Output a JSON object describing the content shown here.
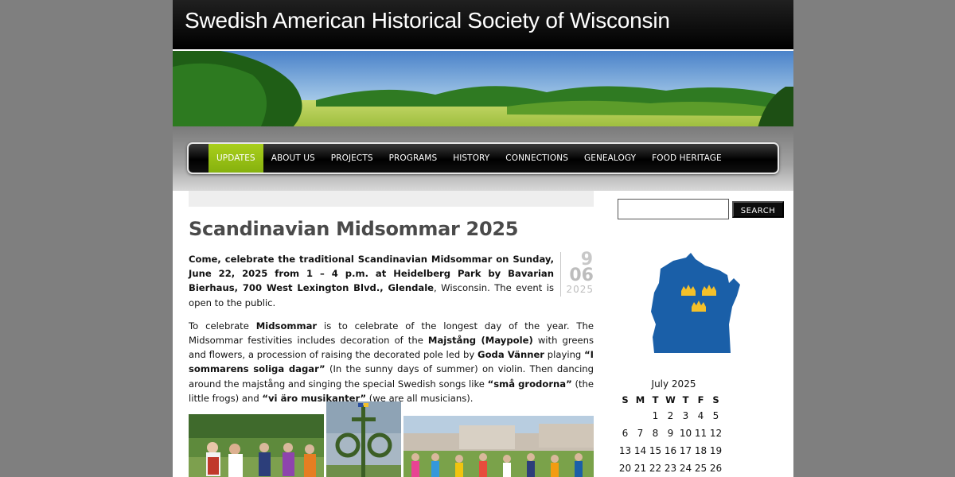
{
  "site": {
    "title": "Swedish American Historical Society of Wisconsin"
  },
  "nav": {
    "items": [
      "UPDATES",
      "ABOUT US",
      "PROJECTS",
      "PROGRAMS",
      "HISTORY",
      "CONNECTIONS",
      "GENEALOGY",
      "FOOD HERITAGE"
    ],
    "active": "UPDATES"
  },
  "post": {
    "title": "Scandinavian Midsommar 2025",
    "date": {
      "day": "9",
      "month": "06",
      "year": "2025"
    },
    "intro": {
      "bold": "Come, celebrate the traditional Scandinavian Midsommar on Sunday, June 22, 2025 from 1 – 4 p.m. at Heidelberg Park by Bavarian Bierhaus, 700 West Lexington Blvd., Glendale",
      "rest": ", Wisconsin. The event is open to the public."
    },
    "para2": [
      {
        "t": "To celebrate ",
        "b": false
      },
      {
        "t": "Midsommar",
        "b": true
      },
      {
        "t": " is to celebrate of the longest day of the year. The Midsommar festivities includes decoration of the ",
        "b": false
      },
      {
        "t": "Majstång (Maypole)",
        "b": true
      },
      {
        "t": " with greens and flowers, a procession of raising the decorated pole led by ",
        "b": false
      },
      {
        "t": "Goda Vänner",
        "b": true
      },
      {
        "t": " playing ",
        "b": false
      },
      {
        "t": "“I sommarens soliga dagar”",
        "b": true
      },
      {
        "t": " (In the sunny days of summer) on violin. Then dancing around the majstång and singing the special Swedish songs like ",
        "b": false
      },
      {
        "t": "“små grodorna”",
        "b": true
      },
      {
        "t": " (the little frogs) and ",
        "b": false
      },
      {
        "t": "“vi äro musikanter”",
        "b": true
      },
      {
        "t": " (we are all musicians).",
        "b": false
      }
    ]
  },
  "sidebar": {
    "search_button": "SEARCH",
    "search_value": ""
  },
  "calendar": {
    "caption": "July 2025",
    "headers": [
      "S",
      "M",
      "T",
      "W",
      "T",
      "F",
      "S"
    ],
    "rows": [
      [
        "",
        "",
        "1",
        "2",
        "3",
        "4",
        "5"
      ],
      [
        "6",
        "7",
        "8",
        "9",
        "10",
        "11",
        "12"
      ],
      [
        "13",
        "14",
        "15",
        "16",
        "17",
        "18",
        "19"
      ],
      [
        "20",
        "21",
        "22",
        "23",
        "24",
        "25",
        "26"
      ]
    ]
  },
  "colors": {
    "nav_active": "#9fc416",
    "map_blue": "#1a5fa8",
    "crown_gold": "#f4c02a"
  }
}
